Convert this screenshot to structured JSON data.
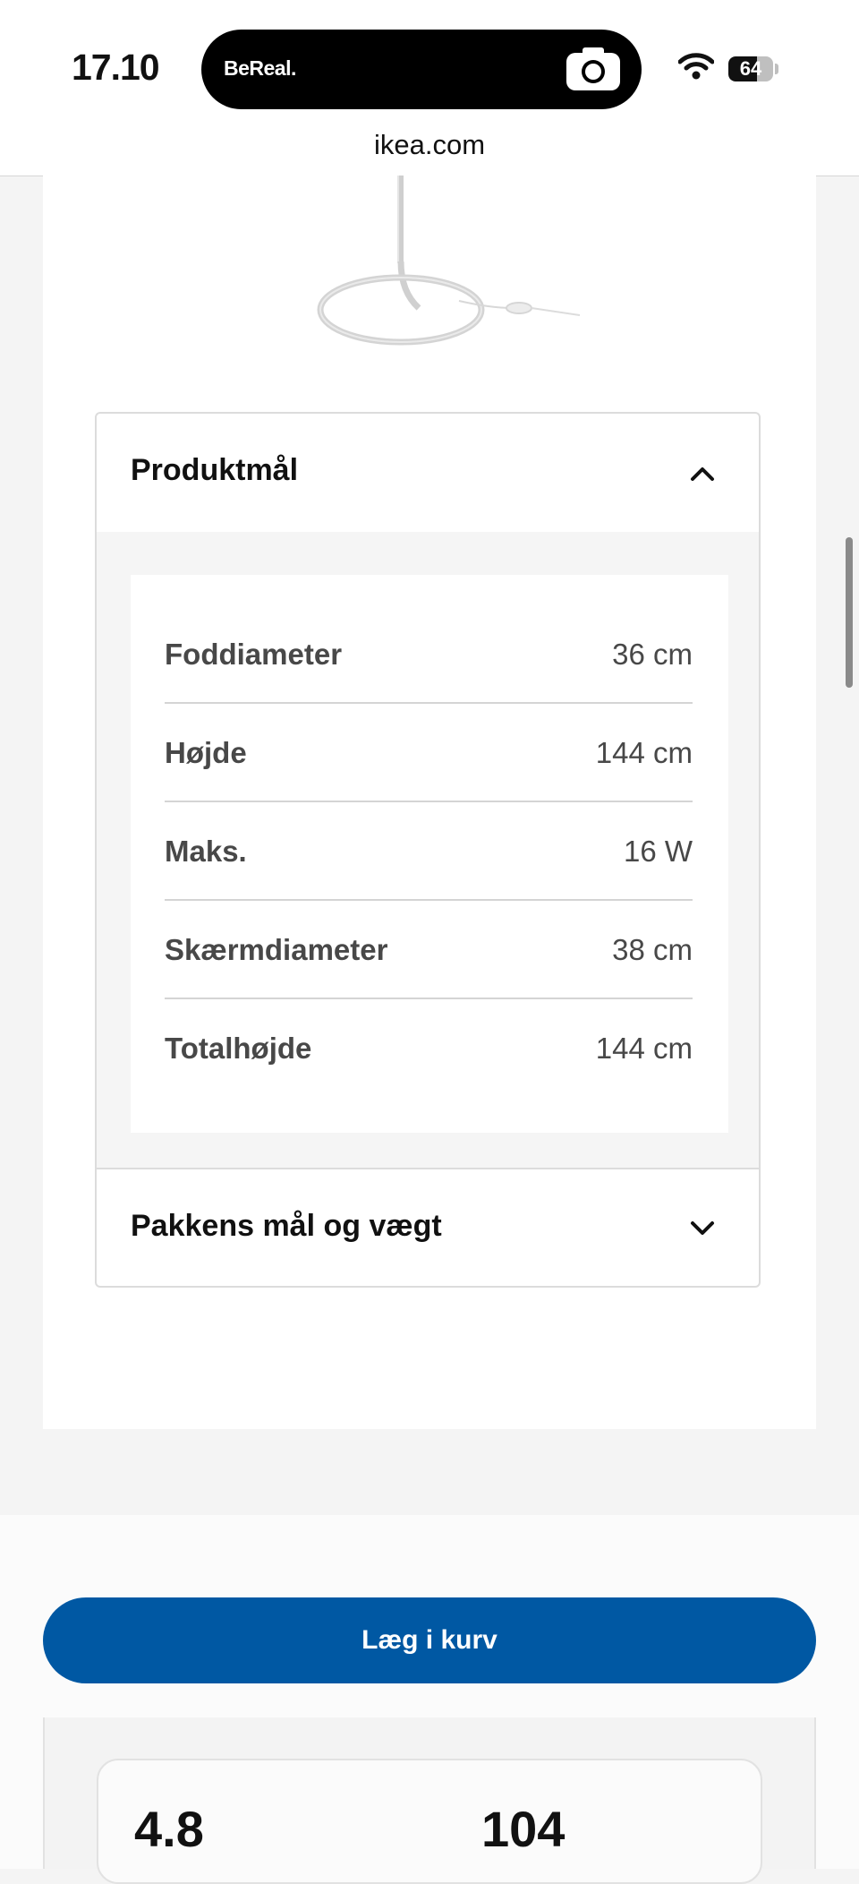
{
  "status_bar": {
    "time": "17.10",
    "island_app": "BeReal.",
    "island_icon": "camera-icon",
    "wifi_icon": "wifi-icon",
    "battery": "64",
    "battery_level": 0.64
  },
  "browser": {
    "url": "ikea.com"
  },
  "product": {
    "image": "floor-lamp-base-image",
    "dimensions_section": {
      "title": "Produktmål",
      "expanded": true,
      "rows": [
        {
          "label": "Foddiameter",
          "value": "36 cm"
        },
        {
          "label": "Højde",
          "value": "144 cm"
        },
        {
          "label": "Maks.",
          "value": "16 W"
        },
        {
          "label": "Skærmdiameter",
          "value": "38 cm"
        },
        {
          "label": "Totalhøjde",
          "value": "144 cm"
        }
      ]
    },
    "package_section": {
      "title": "Pakkens mål og vægt",
      "expanded": false
    }
  },
  "cart_button": {
    "label": "Læg i kurv",
    "color": "#0058a3"
  },
  "rating": {
    "value": "4.8",
    "count": "104"
  }
}
